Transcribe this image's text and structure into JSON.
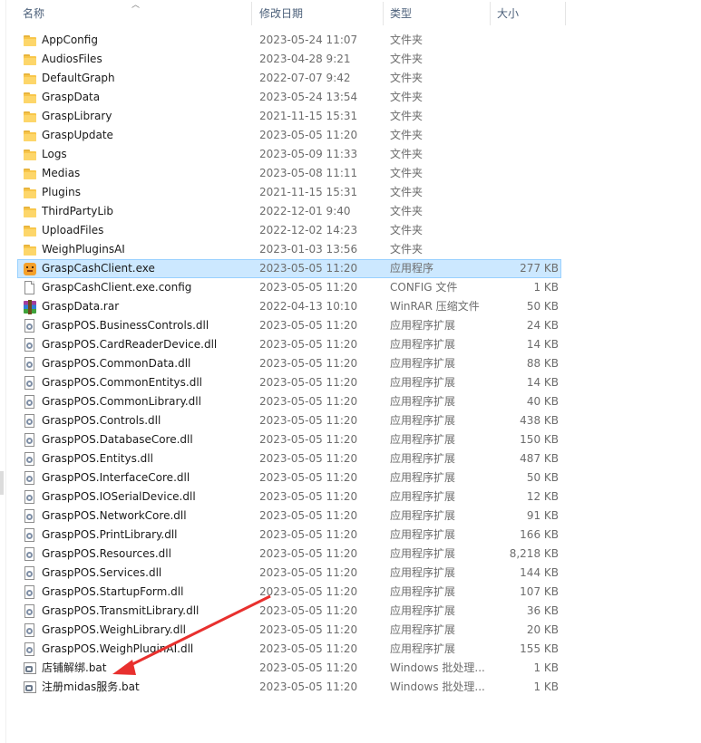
{
  "header": {
    "name": "名称",
    "date": "修改日期",
    "type": "类型",
    "size": "大小"
  },
  "accent_color": "#cce8ff",
  "annotation_arrow_color": "#e8302e",
  "files": [
    {
      "name": "AppConfig",
      "date": "2023-05-24 11:07",
      "type": "文件夹",
      "size": "",
      "icon": "folder-icon"
    },
    {
      "name": "AudiosFiles",
      "date": "2023-04-28 9:21",
      "type": "文件夹",
      "size": "",
      "icon": "folder-icon"
    },
    {
      "name": "DefaultGraph",
      "date": "2022-07-07 9:42",
      "type": "文件夹",
      "size": "",
      "icon": "folder-icon"
    },
    {
      "name": "GraspData",
      "date": "2023-05-24 13:54",
      "type": "文件夹",
      "size": "",
      "icon": "folder-icon"
    },
    {
      "name": "GraspLibrary",
      "date": "2021-11-15 15:31",
      "type": "文件夹",
      "size": "",
      "icon": "folder-icon"
    },
    {
      "name": "GraspUpdate",
      "date": "2023-05-05 11:20",
      "type": "文件夹",
      "size": "",
      "icon": "folder-icon"
    },
    {
      "name": "Logs",
      "date": "2023-05-09 11:33",
      "type": "文件夹",
      "size": "",
      "icon": "folder-icon"
    },
    {
      "name": "Medias",
      "date": "2023-05-08 11:11",
      "type": "文件夹",
      "size": "",
      "icon": "folder-icon"
    },
    {
      "name": "Plugins",
      "date": "2021-11-15 15:31",
      "type": "文件夹",
      "size": "",
      "icon": "folder-icon"
    },
    {
      "name": "ThirdPartyLib",
      "date": "2022-12-01 9:40",
      "type": "文件夹",
      "size": "",
      "icon": "folder-icon"
    },
    {
      "name": "UploadFiles",
      "date": "2022-12-02 14:23",
      "type": "文件夹",
      "size": "",
      "icon": "folder-icon"
    },
    {
      "name": "WeighPluginsAI",
      "date": "2023-01-03 13:56",
      "type": "文件夹",
      "size": "",
      "icon": "folder-icon"
    },
    {
      "name": "GraspCashClient.exe",
      "date": "2023-05-05 11:20",
      "type": "应用程序",
      "size": "277 KB",
      "icon": "app-icon",
      "selected": true
    },
    {
      "name": "GraspCashClient.exe.config",
      "date": "2023-05-05 11:20",
      "type": "CONFIG 文件",
      "size": "1 KB",
      "icon": "page-icon"
    },
    {
      "name": "GraspData.rar",
      "date": "2022-04-13 10:10",
      "type": "WinRAR 压缩文件",
      "size": "50 KB",
      "icon": "rar-icon"
    },
    {
      "name": "GraspPOS.BusinessControls.dll",
      "date": "2023-05-05 11:20",
      "type": "应用程序扩展",
      "size": "24 KB",
      "icon": "dll-icon"
    },
    {
      "name": "GraspPOS.CardReaderDevice.dll",
      "date": "2023-05-05 11:20",
      "type": "应用程序扩展",
      "size": "14 KB",
      "icon": "dll-icon"
    },
    {
      "name": "GraspPOS.CommonData.dll",
      "date": "2023-05-05 11:20",
      "type": "应用程序扩展",
      "size": "88 KB",
      "icon": "dll-icon"
    },
    {
      "name": "GraspPOS.CommonEntitys.dll",
      "date": "2023-05-05 11:20",
      "type": "应用程序扩展",
      "size": "14 KB",
      "icon": "dll-icon"
    },
    {
      "name": "GraspPOS.CommonLibrary.dll",
      "date": "2023-05-05 11:20",
      "type": "应用程序扩展",
      "size": "40 KB",
      "icon": "dll-icon"
    },
    {
      "name": "GraspPOS.Controls.dll",
      "date": "2023-05-05 11:20",
      "type": "应用程序扩展",
      "size": "438 KB",
      "icon": "dll-icon"
    },
    {
      "name": "GraspPOS.DatabaseCore.dll",
      "date": "2023-05-05 11:20",
      "type": "应用程序扩展",
      "size": "150 KB",
      "icon": "dll-icon"
    },
    {
      "name": "GraspPOS.Entitys.dll",
      "date": "2023-05-05 11:20",
      "type": "应用程序扩展",
      "size": "487 KB",
      "icon": "dll-icon"
    },
    {
      "name": "GraspPOS.InterfaceCore.dll",
      "date": "2023-05-05 11:20",
      "type": "应用程序扩展",
      "size": "50 KB",
      "icon": "dll-icon"
    },
    {
      "name": "GraspPOS.IOSerialDevice.dll",
      "date": "2023-05-05 11:20",
      "type": "应用程序扩展",
      "size": "12 KB",
      "icon": "dll-icon"
    },
    {
      "name": "GraspPOS.NetworkCore.dll",
      "date": "2023-05-05 11:20",
      "type": "应用程序扩展",
      "size": "91 KB",
      "icon": "dll-icon"
    },
    {
      "name": "GraspPOS.PrintLibrary.dll",
      "date": "2023-05-05 11:20",
      "type": "应用程序扩展",
      "size": "166 KB",
      "icon": "dll-icon"
    },
    {
      "name": "GraspPOS.Resources.dll",
      "date": "2023-05-05 11:20",
      "type": "应用程序扩展",
      "size": "8,218 KB",
      "icon": "dll-icon"
    },
    {
      "name": "GraspPOS.Services.dll",
      "date": "2023-05-05 11:20",
      "type": "应用程序扩展",
      "size": "144 KB",
      "icon": "dll-icon"
    },
    {
      "name": "GraspPOS.StartupForm.dll",
      "date": "2023-05-05 11:20",
      "type": "应用程序扩展",
      "size": "107 KB",
      "icon": "dll-icon"
    },
    {
      "name": "GraspPOS.TransmitLibrary.dll",
      "date": "2023-05-05 11:20",
      "type": "应用程序扩展",
      "size": "36 KB",
      "icon": "dll-icon"
    },
    {
      "name": "GraspPOS.WeighLibrary.dll",
      "date": "2023-05-05 11:20",
      "type": "应用程序扩展",
      "size": "20 KB",
      "icon": "dll-icon"
    },
    {
      "name": "GraspPOS.WeighPluginAI.dll",
      "date": "2023-05-05 11:20",
      "type": "应用程序扩展",
      "size": "155 KB",
      "icon": "dll-icon"
    },
    {
      "name": "店铺解绑.bat",
      "date": "2023-05-05 11:20",
      "type": "Windows 批处理...",
      "size": "1 KB",
      "icon": "batch-icon"
    },
    {
      "name": "注册midas服务.bat",
      "date": "2023-05-05 11:20",
      "type": "Windows 批处理...",
      "size": "1 KB",
      "icon": "batch-icon"
    }
  ]
}
